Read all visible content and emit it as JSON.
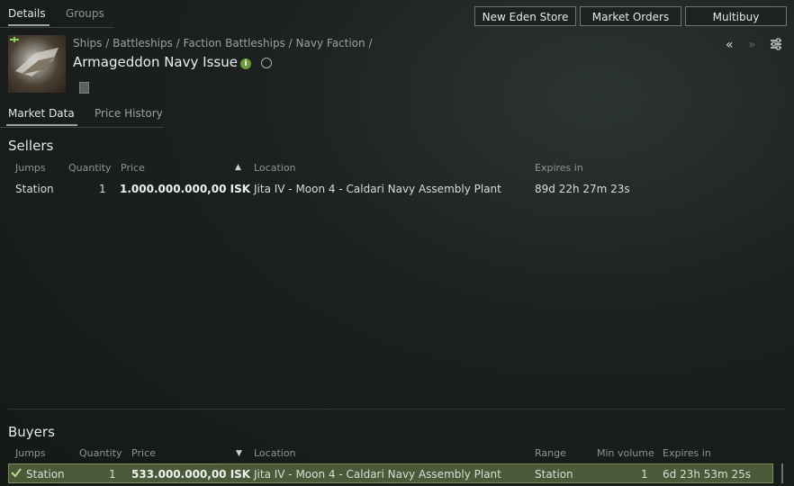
{
  "top_tabs": [
    "Details",
    "Groups"
  ],
  "top_buttons": [
    "New Eden Store",
    "Market Orders",
    "Multibuy"
  ],
  "item": {
    "breadcrumb": "Ships / Battleships / Faction Battleships / Navy Faction /",
    "name": "Armageddon Navy Issue"
  },
  "sub_tabs": [
    "Market Data",
    "Price History"
  ],
  "sellers": {
    "title": "Sellers",
    "columns": [
      "Jumps",
      "Quantity",
      "Price",
      "Location",
      "Expires in"
    ],
    "sort_indicator": "▲",
    "rows": [
      {
        "jumps": "Station",
        "quantity": "1",
        "price": "1.000.000.000,00 ISK",
        "location": "Jita IV - Moon 4 - Caldari Navy Assembly Plant",
        "expires": "89d 22h 27m 23s"
      }
    ]
  },
  "buyers": {
    "title": "Buyers",
    "columns": [
      "Jumps",
      "Quantity",
      "Price",
      "Location",
      "Range",
      "Min volume",
      "Expires in"
    ],
    "sort_indicator": "▼",
    "rows": [
      {
        "jumps": "Station",
        "quantity": "1",
        "price": "533.000.000,00 ISK",
        "location": "Jita IV - Moon 4 - Caldari Navy Assembly Plant",
        "range": "Station",
        "min_volume": "1",
        "expires": "6d 23h 53m 25s"
      }
    ]
  },
  "colors": {
    "selected_row": "#4a5a38",
    "info_icon": "#6a9a3a"
  }
}
